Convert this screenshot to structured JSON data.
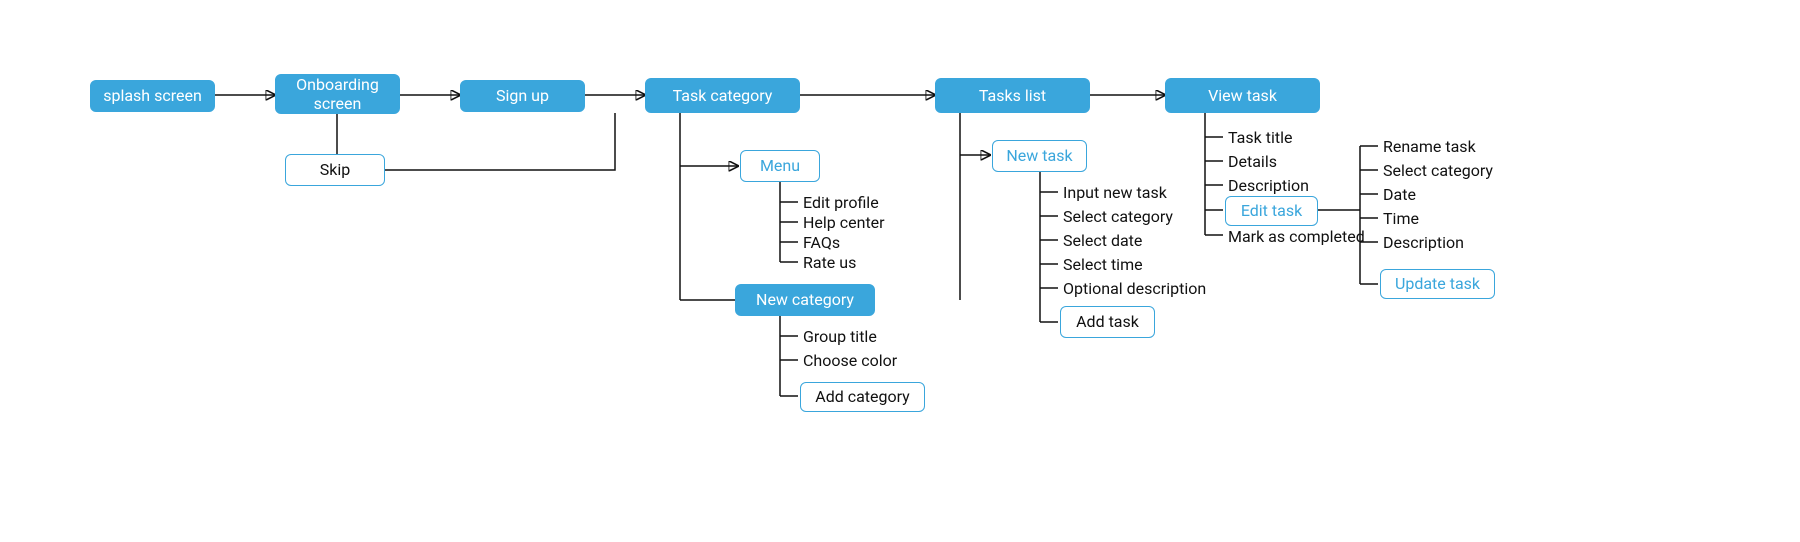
{
  "nodes": {
    "splash": "splash screen",
    "onboarding": "Onboarding screen",
    "signup": "Sign up",
    "task_category": "Task category",
    "tasks_list": "Tasks list",
    "view_task": "View task",
    "skip": "Skip",
    "menu": "Menu",
    "new_category": "New category",
    "add_category": "Add category",
    "new_task": "New task",
    "add_task": "Add task",
    "edit_task": "Edit task",
    "update_task": "Update task"
  },
  "leaves": {
    "menu": {
      "edit_profile": "Edit profile",
      "help_center": "Help center",
      "faqs": "FAQs",
      "rate_us": "Rate us"
    },
    "new_category": {
      "group_title": "Group title",
      "choose_color": "Choose color"
    },
    "new_task": {
      "input_new_task": "Input new task",
      "select_category": "Select category",
      "select_date": "Select date",
      "select_time": "Select time",
      "optional_desc": "Optional description"
    },
    "view_task": {
      "task_title": "Task title",
      "details": "Details",
      "description": "Description",
      "mark_completed": "Mark as completed"
    },
    "edit_task": {
      "rename_task": "Rename task",
      "select_category": "Select category",
      "date": "Date",
      "time": "Time",
      "description": "Description"
    }
  }
}
